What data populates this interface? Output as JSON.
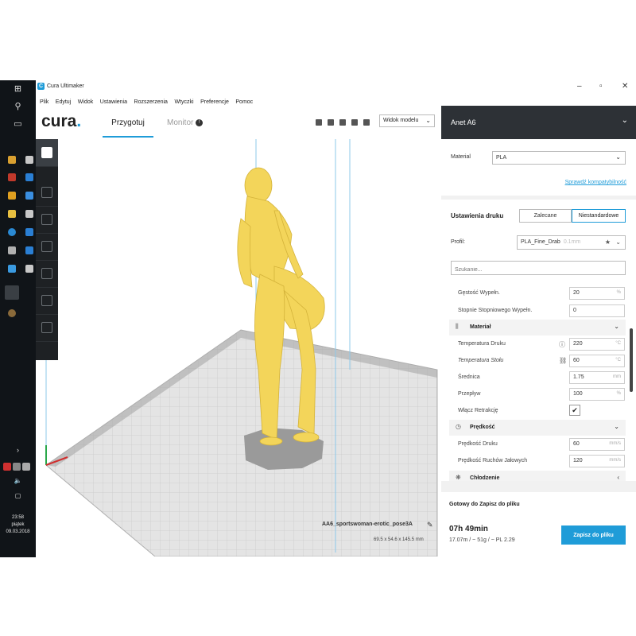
{
  "window": {
    "title": "Cura Ultimaker",
    "app_logo": "C",
    "minimize": "–",
    "maximize": "▫",
    "close": "✕"
  },
  "menu": [
    "Plik",
    "Edytuj",
    "Widok",
    "Ustawienia",
    "Rozszerzenia",
    "Wtyczki",
    "Preferencje",
    "Pomoc"
  ],
  "header": {
    "brand": "cura",
    "brand_dot": ".",
    "tab_prepare": "Przygotuj",
    "tab_monitor": "Monitor",
    "monitor_icon": "!",
    "view_select": "Widok modelu"
  },
  "viewport": {
    "model_name": "AA6_sportswoman-erotic_pose3A",
    "model_dims": "69.5 x 54.6 x 145.5 mm",
    "model_color": "#f3d55a",
    "plate_color": "#dcdcdc",
    "accent": "#1f9cd8"
  },
  "taskbar": {
    "time": "23:58",
    "day": "piątek",
    "date": "09.03.2018"
  },
  "sidebar": {
    "printer": "Anet A6",
    "material_label": "Material",
    "material_value": "PLA",
    "compat_link": "Sprawdź kompatybilność",
    "settings_title": "Ustawienia druku",
    "btn_recommended": "Zalecane",
    "btn_custom": "Niestandardowe",
    "profile_label": "Profil:",
    "profile_value": "PLA_Fine_Drab",
    "profile_layer": "0.1mm",
    "search_placeholder": "Szukanie...",
    "rows": {
      "infill_density": {
        "label": "Gęstość Wypełn.",
        "value": "20",
        "unit": "%"
      },
      "gradual_infill": {
        "label": "Stopnie Stopniowego Wypełn.",
        "value": "0"
      },
      "material_category": "Materiał",
      "print_temp": {
        "label": "Temperatura Druku",
        "value": "220",
        "unit": "°C"
      },
      "bed_temp": {
        "label": "Temperatura Stołu",
        "value": "60",
        "unit": "°C"
      },
      "diameter": {
        "label": "Średnica",
        "value": "1.75",
        "unit": "mm"
      },
      "flow": {
        "label": "Przepływ",
        "value": "100",
        "unit": "%"
      },
      "retraction": {
        "label": "Włącz Retrakcję",
        "checked": "✔"
      },
      "speed_category": "Prędkość",
      "print_speed": {
        "label": "Prędkość Druku",
        "value": "60",
        "unit": "mm/s"
      },
      "travel_speed": {
        "label": "Prędkość Ruchów Jałowych",
        "value": "120",
        "unit": "mm/s"
      },
      "cooling_category": "Chłodzenie"
    },
    "ready_label": "Gotowy do Zapisz do pliku",
    "print_time": "07h 49min",
    "print_stats": "17.07m / ~ 51g / ~ PL 2.29",
    "save_button": "Zapisz do pliku"
  }
}
